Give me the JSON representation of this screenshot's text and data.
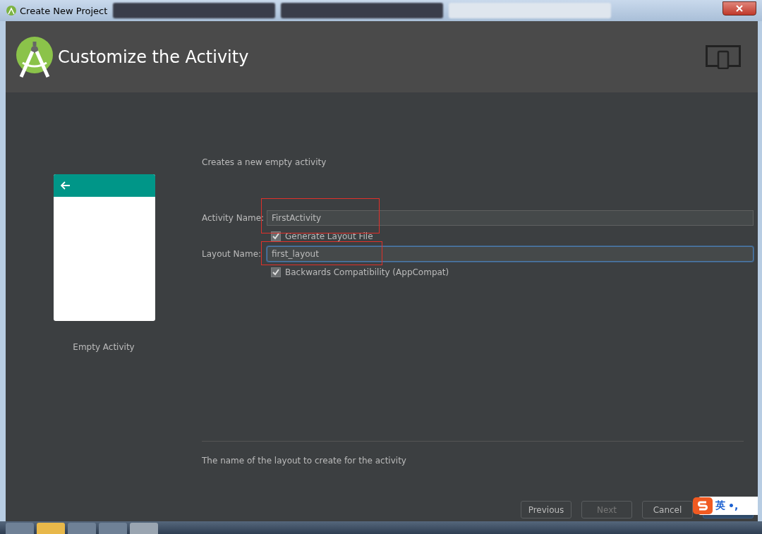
{
  "window": {
    "title": "Create New Project"
  },
  "browser_tabs": [
    {
      "selected": false
    },
    {
      "selected": false
    },
    {
      "selected": true
    }
  ],
  "header": {
    "title": "Customize the Activity"
  },
  "template": {
    "name": "Empty Activity"
  },
  "description": "Creates a new empty activity",
  "fields": [
    {
      "label": "Activity Name:",
      "value": "FirstActivity",
      "focused": false,
      "highlighted": true
    },
    {
      "label": "Layout Name:",
      "value": "first_layout",
      "focused": true,
      "highlighted": true
    }
  ],
  "checkboxes": [
    {
      "label": "Generate Layout File",
      "checked": true
    },
    {
      "label": "Backwards Compatibility (AppCompat)",
      "checked": true
    }
  ],
  "help_text": "The name of the layout to create for the activity",
  "buttons": [
    {
      "label": "Previous",
      "disabled": false,
      "kind": "plain"
    },
    {
      "label": "Next",
      "disabled": true,
      "kind": "plain"
    },
    {
      "label": "Cancel",
      "disabled": false,
      "kind": "plain"
    },
    {
      "kind": "default"
    }
  ],
  "ime": {
    "mode": "英",
    "punct": "•,"
  }
}
